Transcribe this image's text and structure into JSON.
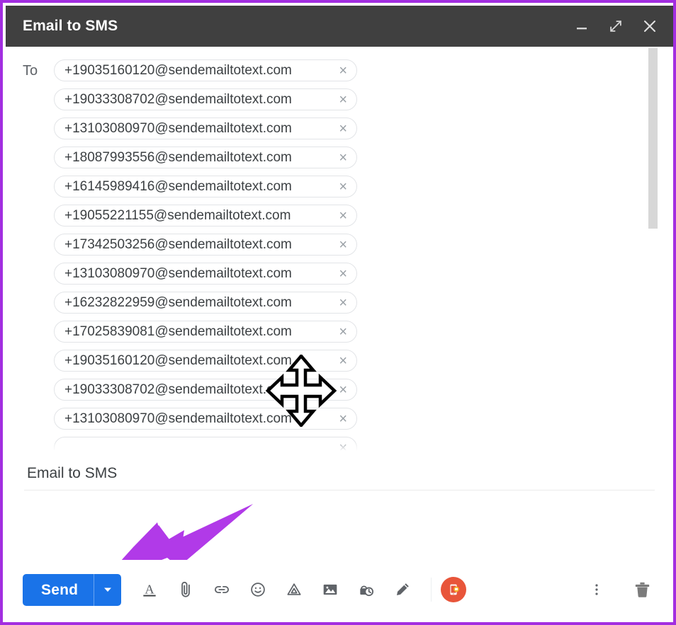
{
  "window": {
    "title": "Email to SMS",
    "border_color": "#a22ee0",
    "titlebar_color": "#404040",
    "controls": [
      {
        "name": "minimize",
        "label": "Minimize"
      },
      {
        "name": "fullscreen",
        "label": "Full screen"
      },
      {
        "name": "close",
        "label": "Close"
      }
    ]
  },
  "compose": {
    "to_label": "To",
    "remove_symbol": "×",
    "recipients": [
      "+19035160120@sendemailtotext.com",
      "+19033308702@sendemailtotext.com",
      "+13103080970@sendemailtotext.com",
      "+18087993556@sendemailtotext.com",
      "+16145989416@sendemailtotext.com",
      "+19055221155@sendemailtotext.com",
      "+17342503256@sendemailtotext.com",
      "+13103080970@sendemailtotext.com",
      "+16232822959@sendemailtotext.com",
      "+17025839081@sendemailtotext.com",
      "+19035160120@sendemailtotext.com",
      "+19033308702@sendemailtotext.com",
      "+13103080970@sendemailtotext.com"
    ],
    "subject": "Email to SMS",
    "body": ""
  },
  "toolbar": {
    "send_label": "Send",
    "send_color": "#1a73e8",
    "send_options_label": "More send options",
    "items": [
      {
        "name": "formatting-options-icon",
        "label": "Formatting options"
      },
      {
        "name": "attach-file-icon",
        "label": "Attach files"
      },
      {
        "name": "insert-link-icon",
        "label": "Insert link"
      },
      {
        "name": "insert-emoji-icon",
        "label": "Insert emoji"
      },
      {
        "name": "insert-drive-file-icon",
        "label": "Insert files using Drive"
      },
      {
        "name": "insert-photo-icon",
        "label": "Insert photo"
      },
      {
        "name": "confidential-mode-icon",
        "label": "Toggle confidential mode"
      },
      {
        "name": "insert-signature-icon",
        "label": "Insert signature"
      }
    ],
    "addon": {
      "name": "sms-addon-icon",
      "label": "Email to SMS add-on",
      "color": "#e8553a"
    },
    "more_options_label": "More options",
    "discard_label": "Discard draft"
  },
  "annotations": {
    "arrow_color": "#b13ae8",
    "arrow_target": "Send",
    "cursor": "move"
  }
}
